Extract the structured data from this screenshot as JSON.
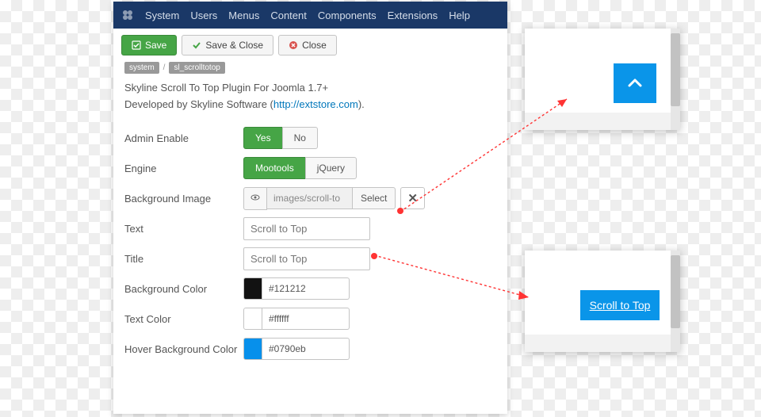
{
  "menubar": [
    "System",
    "Users",
    "Menus",
    "Content",
    "Components",
    "Extensions",
    "Help"
  ],
  "toolbar": {
    "save_label": "Save",
    "save_close_label": "Save & Close",
    "close_label": "Close"
  },
  "crumbs": {
    "a": "system",
    "b": "sl_scrolltotop"
  },
  "desc": {
    "line1": "Skyline Scroll To Top Plugin For Joomla 1.7+",
    "line2_pre": "Developed by Skyline Software (",
    "line2_link": "http://extstore.com",
    "line2_post": ")."
  },
  "form": {
    "admin_enable": {
      "label": "Admin Enable",
      "yes": "Yes",
      "no": "No",
      "value": "Yes"
    },
    "engine": {
      "label": "Engine",
      "opt1": "Mootools",
      "opt2": "jQuery",
      "value": "Mootools"
    },
    "bg_image": {
      "label": "Background Image",
      "path": "images/scroll-to",
      "select": "Select"
    },
    "text": {
      "label": "Text",
      "value": "Scroll to Top"
    },
    "title": {
      "label": "Title",
      "value": "Scroll to Top"
    },
    "bg_color": {
      "label": "Background Color",
      "value": "#121212"
    },
    "text_color": {
      "label": "Text Color",
      "value": "#ffffff"
    },
    "hover_color": {
      "label": "Hover Background Color",
      "value": "#0790eb"
    }
  },
  "preview": {
    "scroll_text": "Scroll to Top"
  },
  "colors": {
    "primary": "#0a95e9",
    "green": "#46a546",
    "navbar": "#1a3867"
  }
}
